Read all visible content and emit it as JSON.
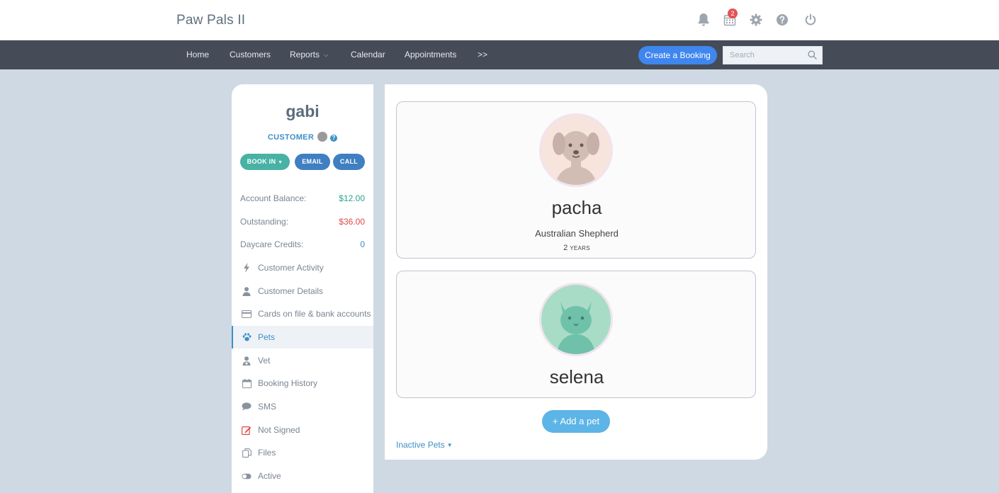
{
  "header": {
    "brand": "Paw Pals II",
    "notification_count": "2",
    "icons": [
      "bell-icon",
      "calendar-icon",
      "gear-icon",
      "help-icon",
      "power-icon"
    ]
  },
  "nav": {
    "items": [
      "Home",
      "Customers",
      "Reports",
      "Calendar",
      "Appointments",
      ">>"
    ],
    "create_booking": "Create a Booking",
    "search_placeholder": "Search"
  },
  "customer": {
    "name": "gabi",
    "type": "CUSTOMER",
    "help_glyph": "?",
    "actions": {
      "book_in": "BOOK IN",
      "email": "EMAIL",
      "call": "CALL"
    },
    "stats": [
      {
        "label": "Account Balance:",
        "value": "$12.00",
        "color": "#2aa58f"
      },
      {
        "label": "Outstanding:",
        "value": "$36.00",
        "color": "#e04848"
      },
      {
        "label": "Daycare Credits:",
        "value": "0",
        "color": "#3d8fc8"
      }
    ],
    "menu": [
      {
        "label": "Customer Activity",
        "icon": "bolt-icon"
      },
      {
        "label": "Customer Details",
        "icon": "user-icon"
      },
      {
        "label": "Cards on file & bank accounts",
        "icon": "credit-card-icon"
      },
      {
        "label": "Pets",
        "icon": "paw-icon",
        "active": true
      },
      {
        "label": "Vet",
        "icon": "doctor-icon"
      },
      {
        "label": "Booking History",
        "icon": "calendar-icon"
      },
      {
        "label": "SMS",
        "icon": "chat-bubble-icon"
      },
      {
        "label": "Not Signed",
        "icon": "edit-icon"
      },
      {
        "label": "Files",
        "icon": "files-icon"
      },
      {
        "label": "Active",
        "icon": "toggle-icon"
      }
    ]
  },
  "pets": [
    {
      "name": "pacha",
      "breed": "Australian Shepherd",
      "age": "2",
      "age_unit": "YEARS",
      "avatar": "dog-avatar-icon"
    },
    {
      "name": "selena",
      "avatar": "cat-avatar-icon"
    }
  ],
  "add_pet_label": "+ Add a pet",
  "inactive_pets_label": "Inactive Pets"
}
